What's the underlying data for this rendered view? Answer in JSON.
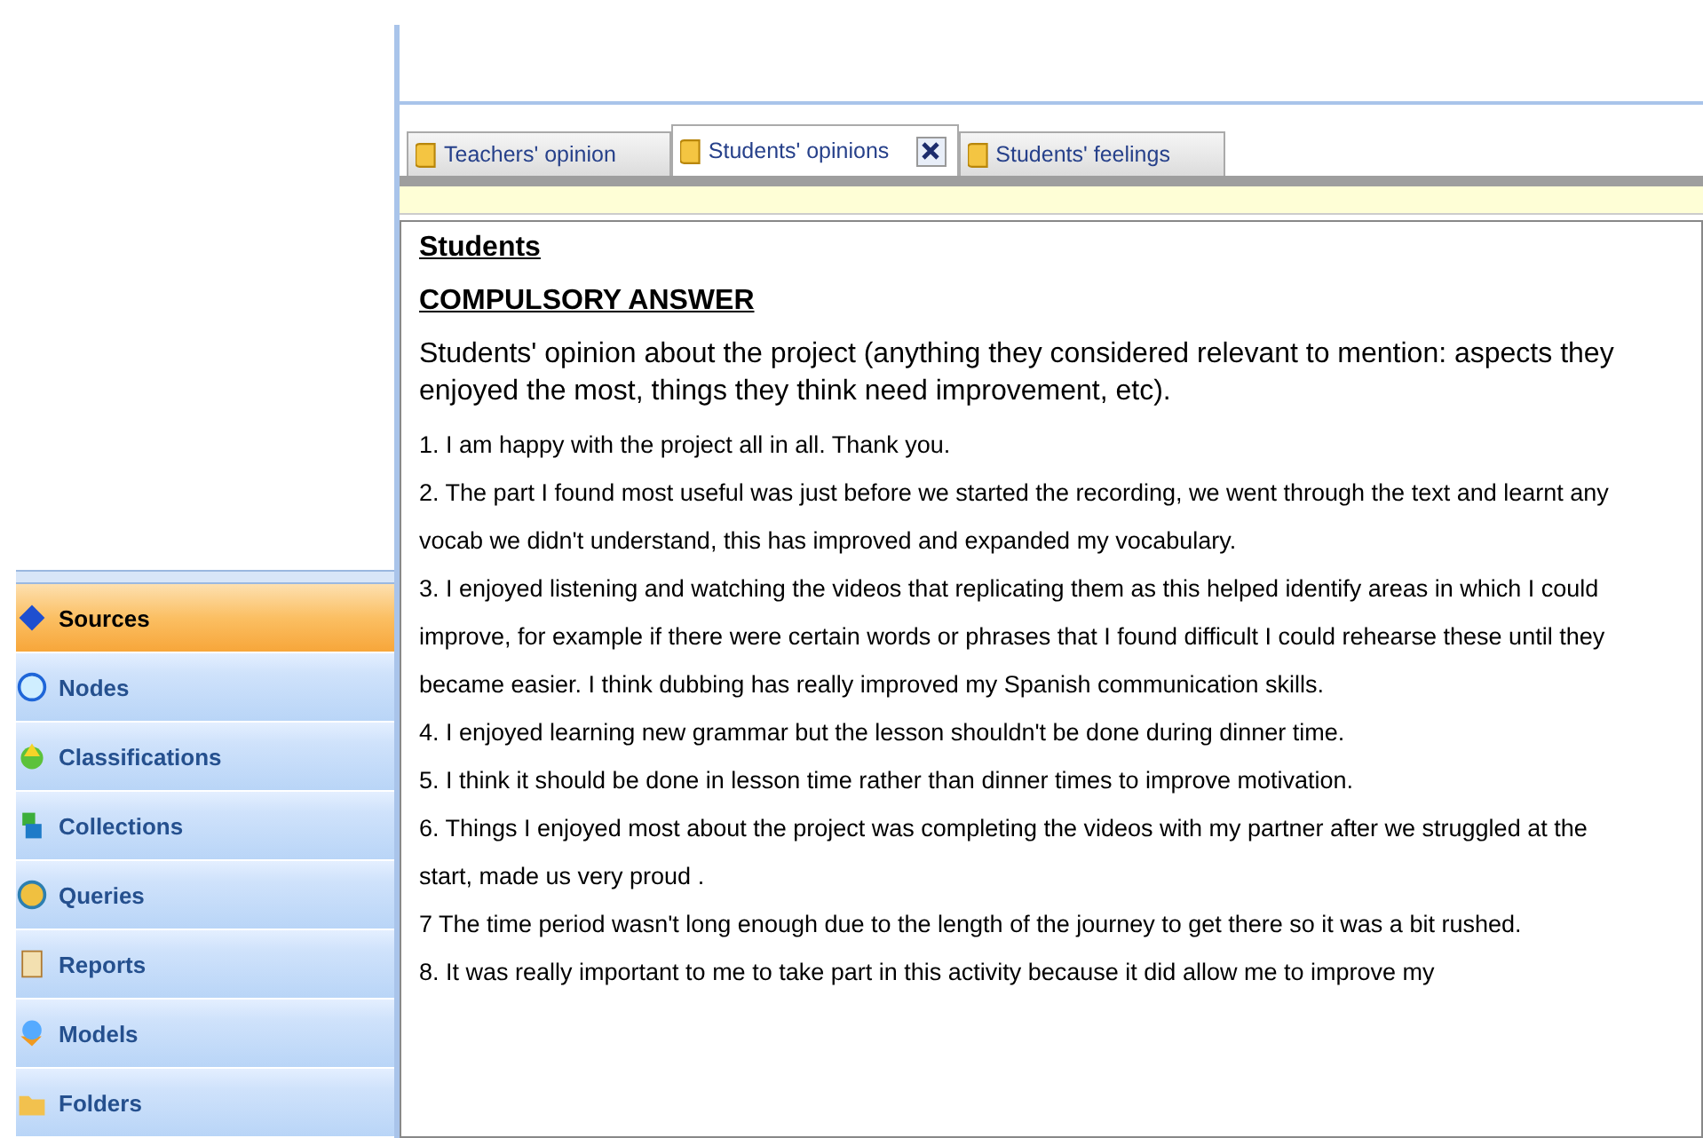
{
  "navigation": [
    {
      "label": "Sources",
      "kind": "sources",
      "selected": true
    },
    {
      "label": "Nodes",
      "kind": "nodes",
      "selected": false
    },
    {
      "label": "Classifications",
      "kind": "classifications",
      "selected": false
    },
    {
      "label": "Collections",
      "kind": "collections",
      "selected": false
    },
    {
      "label": "Queries",
      "kind": "queries",
      "selected": false
    },
    {
      "label": "Reports",
      "kind": "reports",
      "selected": false
    },
    {
      "label": "Models",
      "kind": "models",
      "selected": false
    },
    {
      "label": "Folders",
      "kind": "folders",
      "selected": false
    }
  ],
  "tabs": [
    {
      "label": "Teachers' opinion",
      "selected": false
    },
    {
      "label": "Students' opinions",
      "selected": true
    },
    {
      "label": "Students' feelings",
      "selected": false
    }
  ],
  "document": {
    "title": "Students",
    "subtitle": "COMPULSORY ANSWER",
    "question": "Students' opinion about the project (anything they considered relevant to mention: aspects they enjoyed the most, things they think need improvement, etc).",
    "answers": [
      "1. I am happy with the project all in all. Thank you.",
      "2. The part I found most useful was just before we started the recording, we went through the text and learnt any vocab we didn't understand, this has improved and expanded my vocabulary.",
      "3. I enjoyed listening and watching the videos that replicating them as this helped identify areas in which I could improve, for example if there were certain words or phrases that I found difficult I could rehearse these until they became easier. I think dubbing has really improved my Spanish communication skills.",
      "4. I enjoyed learning new grammar but the lesson shouldn't be done during dinner time.",
      "5. I think it should be done in lesson time rather than dinner times to improve motivation.",
      "6. Things I enjoyed most about the project was completing the videos with my partner after we struggled at the start, made us very proud .",
      "7 The time period wasn't long enough due to the length of the journey to get there so it was a bit rushed.",
      "8. It was really important to me to take part in this activity because it did allow me to improve my"
    ]
  }
}
